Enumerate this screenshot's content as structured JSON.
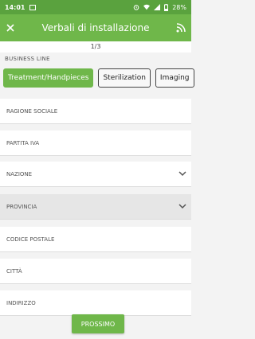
{
  "status": {
    "time": "14:01",
    "battery": "28%"
  },
  "toolbar": {
    "title": "Verbali di installazione"
  },
  "pager": "1/3",
  "business_line": {
    "label": "BUSINESS LINE",
    "chips": [
      {
        "label": "Treatment/Handpieces",
        "active": true
      },
      {
        "label": "Sterilization",
        "active": false
      },
      {
        "label": "Imaging",
        "active": false
      }
    ]
  },
  "fields": [
    {
      "label": "RAGIONE SOCIALE",
      "dropdown": false,
      "disabled": false
    },
    {
      "label": "PARTITA IVA",
      "dropdown": false,
      "disabled": false
    },
    {
      "label": "NAZIONE",
      "dropdown": true,
      "disabled": false
    },
    {
      "label": "PROVINCIA",
      "dropdown": true,
      "disabled": true
    },
    {
      "label": "CODICE POSTALE",
      "dropdown": false,
      "disabled": false
    },
    {
      "label": "CITTÀ",
      "dropdown": false,
      "disabled": false
    },
    {
      "label": "INDIRIZZO",
      "dropdown": false,
      "disabled": false
    }
  ],
  "next_button": "PROSSIMO",
  "colors": {
    "primary": "#6fb74a",
    "status": "#5aa23e"
  }
}
